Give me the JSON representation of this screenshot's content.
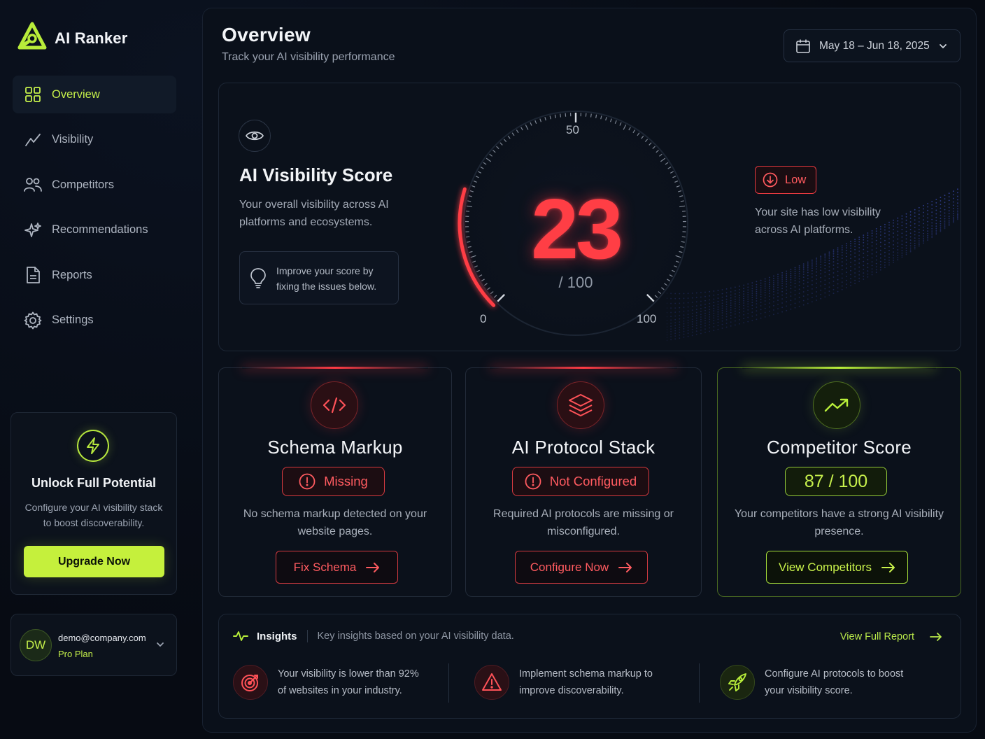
{
  "brand": {
    "name": "AI Ranker"
  },
  "sidebar": {
    "items": [
      {
        "label": "Overview",
        "icon": "grid-icon",
        "active": true
      },
      {
        "label": "Visibility",
        "icon": "trend-line-icon"
      },
      {
        "label": "Competitors",
        "icon": "users-icon"
      },
      {
        "label": "Recommendations",
        "icon": "sparkle-icon"
      },
      {
        "label": "Reports",
        "icon": "document-icon"
      },
      {
        "label": "Settings",
        "icon": "gear-icon"
      }
    ],
    "promo": {
      "title": "Unlock Full Potential",
      "description": "Configure your AI visibility stack to boost discoverability.",
      "button": "Upgrade Now"
    },
    "user": {
      "initials": "DW",
      "email": "demo@company.com",
      "plan": "Pro Plan"
    }
  },
  "header": {
    "title": "Overview",
    "subtitle": "Track your AI visibility performance",
    "date_range": "May 18 – Jun 18, 2025"
  },
  "score": {
    "title": "AI Visibility Score",
    "description": "Your overall visibility across AI platforms and ecosystems.",
    "tip": "Improve your score by fixing the issues below.",
    "value": "23",
    "max_label": "/ 100",
    "value_fraction": 0.23,
    "tick_min": "0",
    "tick_mid": "50",
    "tick_max": "100",
    "status": "Low",
    "status_description": "Your site has low visibility across AI platforms."
  },
  "cards": {
    "schema": {
      "title": "Schema Markup",
      "badge": "Missing",
      "description": "No schema markup detected on your website pages.",
      "button": "Fix Schema"
    },
    "protocol": {
      "title": "AI Protocol Stack",
      "badge": "Not Configured",
      "description": "Required AI protocols are missing or misconfigured.",
      "button": "Configure Now"
    },
    "competitor": {
      "title": "Competitor Score",
      "badge": "87 / 100",
      "description": "Your competitors have a strong AI visibility presence.",
      "button": "View Competitors"
    }
  },
  "insights": {
    "title": "Insights",
    "subtitle": "Key insights based on your AI visibility data.",
    "link": "View Full Report",
    "items": [
      {
        "text": "Your visibility is lower than 92% of websites in your industry.",
        "icon": "target-icon"
      },
      {
        "text": "Implement schema markup to improve discoverability.",
        "icon": "warning-icon"
      },
      {
        "text": "Configure AI protocols to boost your visibility score.",
        "icon": "rocket-icon"
      }
    ]
  },
  "colors": {
    "accent": "#c5f03c",
    "danger": "#ff3e45",
    "background": "#070b13"
  }
}
